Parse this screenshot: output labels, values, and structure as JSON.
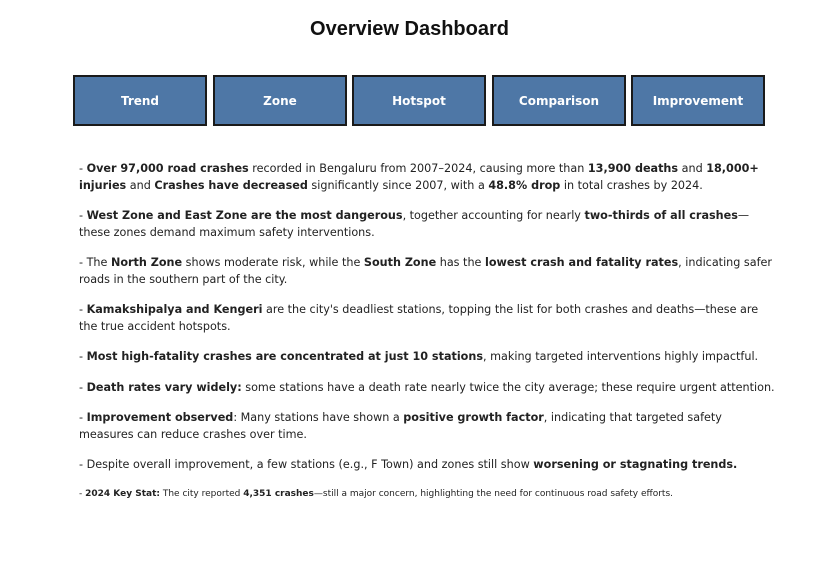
{
  "header": {
    "title": "Overview Dashboard"
  },
  "nav": {
    "buttons": [
      "Trend",
      "Zone",
      "Hotspot",
      "Comparison",
      "Improvement"
    ]
  },
  "insights": [
    {
      "segments": [
        {
          "t": "- ",
          "b": false
        },
        {
          "t": "Over 97,000 road crashes",
          "b": true
        },
        {
          "t": " recorded in Bengaluru from 2007–2024, causing more than ",
          "b": false
        },
        {
          "t": "13,900 deaths",
          "b": true
        },
        {
          "t": " and ",
          "b": false
        },
        {
          "t": "18,000+ injuries",
          "b": true
        },
        {
          "t": " and ",
          "b": false
        },
        {
          "t": "Crashes have decreased",
          "b": true
        },
        {
          "t": " significantly since 2007, with a ",
          "b": false
        },
        {
          "t": "48.8% drop",
          "b": true
        },
        {
          "t": " in total crashes by 2024.",
          "b": false
        }
      ]
    },
    {
      "segments": [
        {
          "t": "- ",
          "b": false
        },
        {
          "t": "West Zone and East Zone are the most dangerous",
          "b": true
        },
        {
          "t": ", together accounting for nearly ",
          "b": false
        },
        {
          "t": "two-thirds of all crashes",
          "b": true
        },
        {
          "t": "—these zones demand maximum safety interventions.",
          "b": false
        }
      ]
    },
    {
      "segments": [
        {
          "t": "- The ",
          "b": false
        },
        {
          "t": "North Zone",
          "b": true
        },
        {
          "t": " shows moderate risk, while the ",
          "b": false
        },
        {
          "t": "South Zone",
          "b": true
        },
        {
          "t": " has the ",
          "b": false
        },
        {
          "t": "lowest crash and fatality rates",
          "b": true
        },
        {
          "t": ", indicating safer roads in the southern part of the city.",
          "b": false
        }
      ]
    },
    {
      "segments": [
        {
          "t": "- ",
          "b": false
        },
        {
          "t": "Kamakshipalya and Kengeri",
          "b": true
        },
        {
          "t": " are the city's deadliest stations, topping the list for both crashes and deaths—these are the true accident hotspots.",
          "b": false
        }
      ]
    },
    {
      "segments": [
        {
          "t": "- ",
          "b": false
        },
        {
          "t": "Most high-fatality crashes are concentrated at just 10 stations",
          "b": true
        },
        {
          "t": ", making targeted interventions highly impactful.",
          "b": false
        }
      ]
    },
    {
      "segments": [
        {
          "t": "- ",
          "b": false
        },
        {
          "t": "Death rates vary widely:",
          "b": true
        },
        {
          "t": " some stations have a death rate nearly twice the city average; these require urgent attention.",
          "b": false
        }
      ]
    },
    {
      "segments": [
        {
          "t": "- ",
          "b": false
        },
        {
          "t": "Improvement observed",
          "b": true
        },
        {
          "t": ": Many stations have shown a ",
          "b": false
        },
        {
          "t": "positive growth factor",
          "b": true
        },
        {
          "t": ", indicating that targeted safety measures can reduce crashes over time.",
          "b": false
        }
      ]
    },
    {
      "segments": [
        {
          "t": "- Despite overall improvement, a few stations (e.g., F Town) and zones still show ",
          "b": false
        },
        {
          "t": "worsening or stagnating trends.",
          "b": true
        }
      ]
    }
  ],
  "key_stat": {
    "segments": [
      {
        "t": "- ",
        "b": false
      },
      {
        "t": "2024 Key Stat:",
        "b": true
      },
      {
        "t": " The city reported ",
        "b": false
      },
      {
        "t": "4,351 crashes",
        "b": true
      },
      {
        "t": "—still a major concern, highlighting the need for continuous road safety efforts.",
        "b": false
      }
    ]
  }
}
